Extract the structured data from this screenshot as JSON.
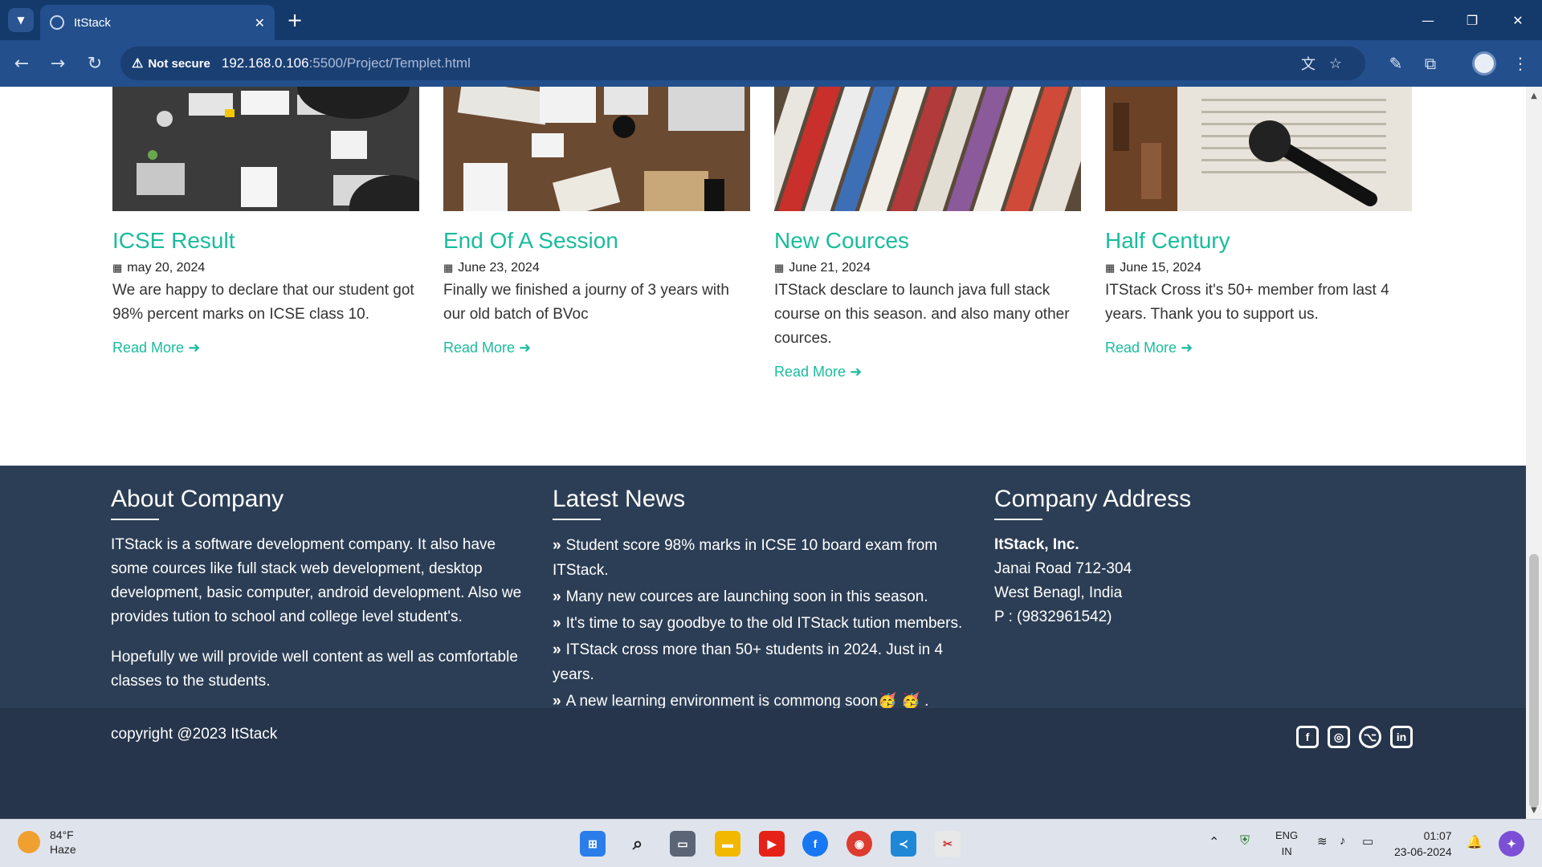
{
  "browser": {
    "tab_title": "ItStack",
    "security_label": "Not secure",
    "url_host": "192.168.0.106",
    "url_path": ":5500/Project/Templet.html"
  },
  "cards": [
    {
      "title": "ICSE Result",
      "date": "may 20, 2024",
      "text": "We are happy to declare that our student got 98% percent marks on ICSE class 10.",
      "more": "Read More"
    },
    {
      "title": "End Of A Session",
      "date": "June 23, 2024",
      "text": "Finally we finished a journy of 3 years with our old batch of BVoc",
      "more": "Read More"
    },
    {
      "title": "New Cources",
      "date": "June 21, 2024",
      "text": "ITStack desclare to launch java full stack course on this season. and also many other cources.",
      "more": "Read More"
    },
    {
      "title": "Half Century",
      "date": "June 15, 2024",
      "text": "ITStack Cross it's 50+ member from last 4 years. Thank you to support us.",
      "more": "Read More"
    }
  ],
  "footer": {
    "about": {
      "heading": "About Company",
      "p1": "ITStack is a software development company. It also have some cources like full stack web development, desktop development, basic computer, android development. Also we provides tution to school and college level student's.",
      "p2": "Hopefully we will provide well content as well as comfortable classes to the students."
    },
    "news": {
      "heading": "Latest News",
      "items": [
        "Student score 98% marks in ICSE 10 board exam from ITStack.",
        "Many new cources are launching soon in this season.",
        "It's time to say goodbye to the old ITStack tution members.",
        "ITStack cross more than 50+ students in 2024. Just in 4 years.",
        "A new learning environment is commong soon🥳 🥳 ."
      ]
    },
    "address": {
      "heading": "Company Address",
      "company": "ItStack, Inc.",
      "line1": "Janai Road 712-304",
      "line2": "West Benagl, India",
      "phone": "P : (9832961542)"
    },
    "copyright": "copyright @2023 ItStack"
  },
  "taskbar": {
    "temp": "84°F",
    "condition": "Haze",
    "lang1": "ENG",
    "lang2": "IN",
    "time": "01:07",
    "date": "23-06-2024"
  },
  "colors": {
    "accent": "#1abc9c",
    "footer_bg": "#2c3e55",
    "chrome_bg": "#143a6b"
  }
}
